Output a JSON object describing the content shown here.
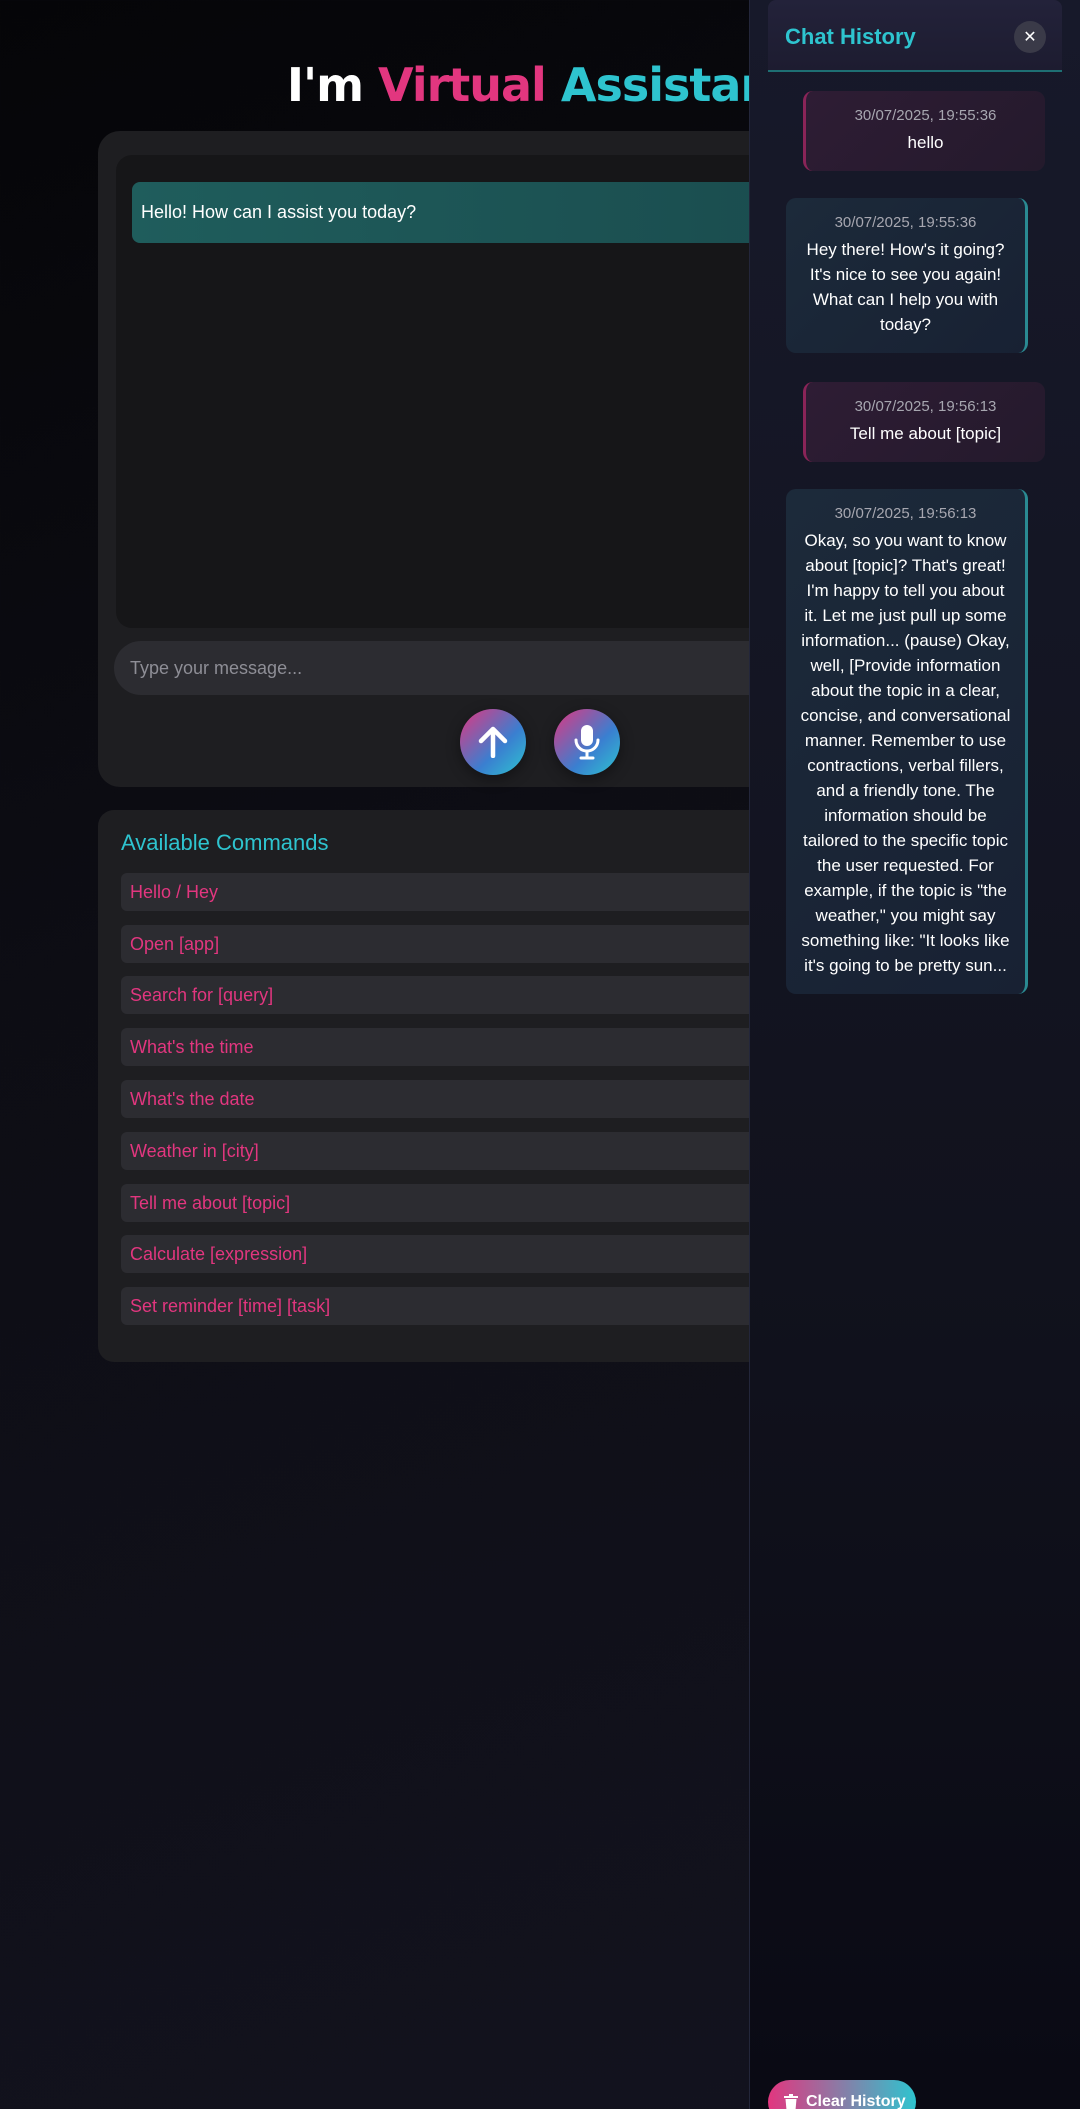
{
  "header": {
    "title_prefix": "I'm",
    "title_word1": "Virtual",
    "title_word2": "Assistant"
  },
  "chat": {
    "bot_greeting": "Hello! How can I assist you today?",
    "input_placeholder": "Type your message...",
    "send_icon": "arrow-up-icon",
    "mic_icon": "microphone-icon"
  },
  "commands": {
    "title": "Available Commands",
    "items": [
      "Hello / Hey",
      "Open [app]",
      "Search for [query]",
      "What's the time",
      "What's the date",
      "Weather in [city]",
      "Tell me about [topic]",
      "Calculate [expression]",
      "Set reminder [time] [task]"
    ]
  },
  "history": {
    "title": "Chat History",
    "close_label": "✕",
    "entries": [
      {
        "role": "user",
        "time": "30/07/2025, 19:55:36",
        "text": "hello"
      },
      {
        "role": "bot",
        "time": "30/07/2025, 19:55:36",
        "text": "Hey there! How's it going? It's nice to see you again! What can I help you with today?"
      },
      {
        "role": "user",
        "time": "30/07/2025, 19:56:13",
        "text": "Tell me about [topic]"
      },
      {
        "role": "bot",
        "time": "30/07/2025, 19:56:13",
        "text": "Okay, so you want to know about [topic]? That's great! I'm happy to tell you about it. Let me just pull up some information... (pause) Okay, well, [Provide information about the topic in a clear, concise, and conversational manner. Remember to use contractions, verbal fillers, and a friendly tone. The information should be tailored to the specific topic the user requested. For example, if the topic is \"the weather,\" you might say something like: \"It looks like it's going to be pretty sun..."
      }
    ],
    "clear_label": "Clear History"
  },
  "colors": {
    "accent_pink": "#e2367f",
    "accent_teal": "#2ec4cf"
  }
}
